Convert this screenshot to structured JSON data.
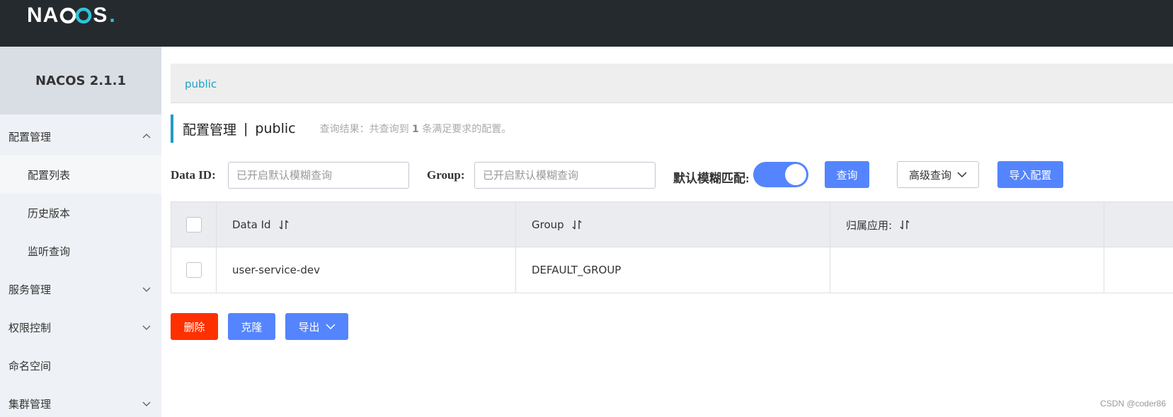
{
  "header": {
    "logo_text_left": "NA",
    "logo_text_right": "S",
    "logo_dot": ".",
    "logo_accent_color": "#2ec5d9",
    "background_color": "#252a2f"
  },
  "sidebar": {
    "version": "NACOS 2.1.1",
    "items": [
      {
        "label": "配置管理",
        "expanded": true,
        "icon": "chevron-up-icon"
      },
      {
        "label": "配置列表",
        "sub": true,
        "active": true
      },
      {
        "label": "历史版本",
        "sub": true
      },
      {
        "label": "监听查询",
        "sub": true
      },
      {
        "label": "服务管理",
        "expanded": false,
        "icon": "chevron-down-icon"
      },
      {
        "label": "权限控制",
        "expanded": false,
        "icon": "chevron-down-icon"
      },
      {
        "label": "命名空间"
      },
      {
        "label": "集群管理",
        "expanded": false,
        "icon": "chevron-down-icon"
      }
    ]
  },
  "namespace_bar": {
    "label": "public"
  },
  "title": {
    "main": "配置管理",
    "separator": "|",
    "namespace": "public",
    "result_prefix": "查询结果：共查询到",
    "result_count": "1",
    "result_suffix": "条满足要求的配置。"
  },
  "filters": {
    "data_id_label": "Data ID:",
    "data_id_placeholder": "已开启默认模糊查询",
    "group_label": "Group:",
    "group_placeholder": "已开启默认模糊查询",
    "fuzzy_label": "默认模糊匹配:",
    "fuzzy_enabled": true,
    "query_button": "查询",
    "advanced_button": "高级查询",
    "import_button": "导入配置"
  },
  "table": {
    "columns": [
      "Data Id",
      "Group",
      "归属应用:"
    ],
    "rows": [
      {
        "data_id": "user-service-dev",
        "group": "DEFAULT_GROUP",
        "app": ""
      }
    ]
  },
  "actions": {
    "delete": "删除",
    "clone": "克隆",
    "export": "导出"
  },
  "colors": {
    "primary": "#5584ff",
    "danger": "#ff3000",
    "accent": "#209bc4"
  },
  "watermark": "CSDN @coder86"
}
